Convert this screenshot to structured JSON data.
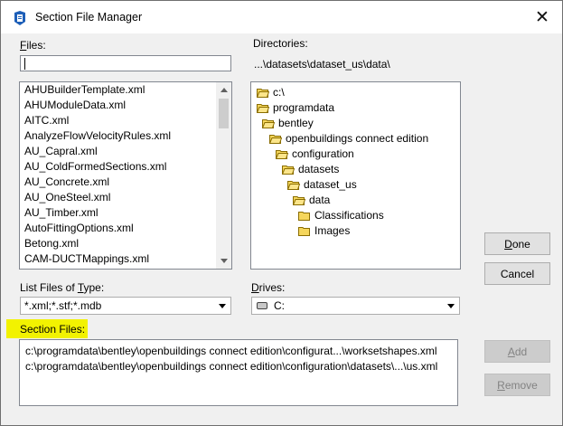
{
  "window": {
    "title": "Section File Manager",
    "close_glyph": "✕",
    "icon": "app-icon"
  },
  "files": {
    "label_mnemonic": "F",
    "label_rest": "iles:",
    "input_value": "",
    "items": [
      "AHUBuilderTemplate.xml",
      "AHUModuleData.xml",
      "AITC.xml",
      "AnalyzeFlowVelocityRules.xml",
      "AU_Capral.xml",
      "AU_ColdFormedSections.xml",
      "AU_Concrete.xml",
      "AU_OneSteel.xml",
      "AU_Timber.xml",
      "AutoFittingOptions.xml",
      "Betong.xml",
      "CAM-DUCTMappings.xml"
    ]
  },
  "directories": {
    "label": "Directories:",
    "current_path": "...\\datasets\\dataset_us\\data\\",
    "tree": [
      {
        "label": "c:\\",
        "open": true
      },
      {
        "label": "programdata",
        "open": true
      },
      {
        "label": "bentley",
        "open": true
      },
      {
        "label": "openbuildings connect edition",
        "open": true
      },
      {
        "label": "configuration",
        "open": true
      },
      {
        "label": "datasets",
        "open": true
      },
      {
        "label": "dataset_us",
        "open": true
      },
      {
        "label": "data",
        "open": true
      },
      {
        "label": "Classifications",
        "open": false
      },
      {
        "label": "Images",
        "open": false
      }
    ]
  },
  "file_type": {
    "label_pre": "List Files of ",
    "label_mnemonic": "T",
    "label_post": "ype:",
    "value": "*.xml;*.stf;*.mdb"
  },
  "drives": {
    "label_mnemonic": "D",
    "label_rest": "rives:",
    "value": "C:"
  },
  "section_files": {
    "label": "Section Files:",
    "items": [
      "c:\\programdata\\bentley\\openbuildings connect edition\\configurat...\\worksetshapes.xml",
      "c:\\programdata\\bentley\\openbuildings connect edition\\configuration\\datasets\\...\\us.xml"
    ]
  },
  "buttons": {
    "done_mnemonic": "D",
    "done_rest": "one",
    "cancel": "Cancel",
    "add_mnemonic": "A",
    "add_rest": "dd",
    "remove_mnemonic": "R",
    "remove_rest": "emove"
  },
  "colors": {
    "highlight": "#f2f200",
    "folder_fill": "#f5d65c",
    "folder_stroke": "#8a6d00",
    "app_icon": "#1d5fb8"
  }
}
